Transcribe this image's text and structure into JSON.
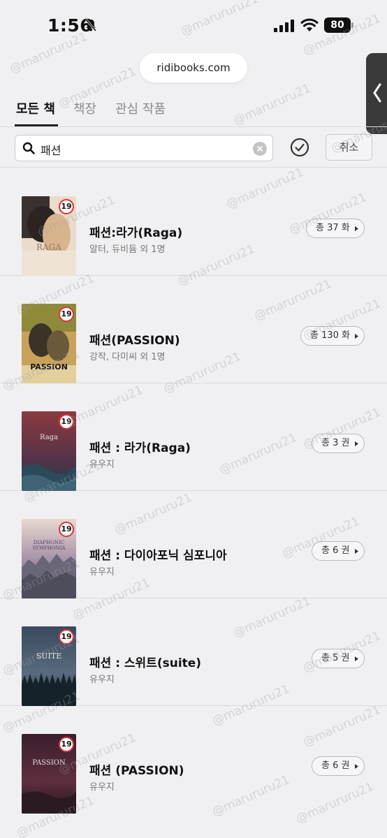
{
  "status": {
    "time": "1:56",
    "battery": "80"
  },
  "browser": {
    "url": "ridibooks.com"
  },
  "tabs": [
    {
      "label": "모든 책"
    },
    {
      "label": "책장"
    },
    {
      "label": "관심 작품"
    }
  ],
  "search": {
    "value": "패션",
    "cancel_label": "취소"
  },
  "books": [
    {
      "title": "패션:라가(Raga)",
      "author": "알터, 듀비듐 외 1명",
      "count": "총 37 화",
      "age": "19",
      "cover_text": "RAGA"
    },
    {
      "title": "패션(PASSION)",
      "author": "강작, 다미씨 외 1명",
      "count": "총 130 화",
      "age": "19",
      "cover_text": "PASSION"
    },
    {
      "title": "패션 : 라가(Raga)",
      "author": "유우지",
      "count": "총 3 권",
      "age": "19",
      "cover_text": "Raga"
    },
    {
      "title": "패션 : 다이아포닉 심포니아",
      "author": "유우지",
      "count": "총 6 권",
      "age": "19",
      "cover_text": "DIAPHONIC SYMPHONIA"
    },
    {
      "title": "패션 : 스위트(suite)",
      "author": "유우지",
      "count": "총 5 권",
      "age": "19",
      "cover_text": "SUITE"
    },
    {
      "title": "패션 (PASSION)",
      "author": "유우지",
      "count": "총 6 권",
      "age": "19",
      "cover_text": "PASSION"
    }
  ],
  "watermark": "@marururu21",
  "colors": {
    "age_badge_border": "#d8343c",
    "background": "#f0f0f2"
  }
}
